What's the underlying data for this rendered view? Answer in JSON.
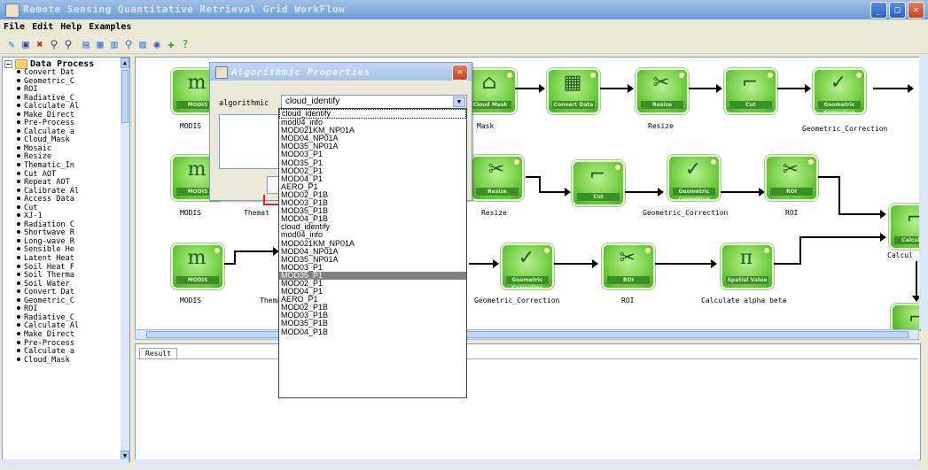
{
  "window": {
    "title": "Remote Sensing Quantitative Retrieval Grid WorkFlow"
  },
  "menu": [
    "File",
    "Edit",
    "Help",
    "Examples"
  ],
  "tree": {
    "root_label": "Data Process",
    "items": [
      "Convert Dat",
      "Geometric_C",
      "ROI",
      "Radiative_C",
      "Calculate Al",
      "Make Direct",
      "Pre-Process",
      "Calculate a",
      "Cloud_Mask",
      "Mosaic",
      "Resize",
      "Thematic_In",
      "Cut AOT",
      "Repeat AOT",
      "Calibrate Al",
      "Access Data",
      "Cut",
      "XJ-1",
      "Radiation C",
      "Shortwave R",
      "Long-wave R",
      "Sensible He",
      "Latent Heat",
      "Soil Heat F",
      "Soil Therma",
      "Soil Water",
      "Convert Dat",
      "Geometric_C",
      "ROI",
      "Radiative_C",
      "Calculate Al",
      "Make Direct",
      "Pre-Process",
      "Calculate a",
      "Cloud_Mask"
    ]
  },
  "canvas": {
    "nodes": [
      {
        "id": "n1",
        "tag": "MODIS",
        "glyph": "m",
        "label": "MODIS"
      },
      {
        "id": "n2",
        "tag": "Cloud Mask",
        "glyph": "⌂",
        "label": "Mask"
      },
      {
        "id": "n3",
        "tag": "Convert Data",
        "glyph": "▦",
        "label": ""
      },
      {
        "id": "n4",
        "tag": "Resize",
        "glyph": "✂",
        "label": "Resize"
      },
      {
        "id": "n5",
        "tag": "Cut",
        "glyph": "⌐",
        "label": ""
      },
      {
        "id": "n6",
        "tag": "Geometric Correction",
        "glyph": "✓",
        "label": "Geometric_Correction"
      },
      {
        "id": "n7",
        "tag": "MODIS",
        "glyph": "m",
        "label": "MODIS"
      },
      {
        "id": "n8",
        "tag": "Resize",
        "glyph": "✂",
        "label": "Resize"
      },
      {
        "id": "n9",
        "tag": "Cut",
        "glyph": "⌐",
        "label": ""
      },
      {
        "id": "n10",
        "tag": "Geometric Correction",
        "glyph": "✓",
        "label": "Geometric_Correction"
      },
      {
        "id": "n11",
        "tag": "ROI",
        "glyph": "✂",
        "label": "ROI"
      },
      {
        "id": "n12",
        "tag": "Calculate",
        "glyph": "⌐",
        "label": "Calcul"
      },
      {
        "id": "n13",
        "tag": "MODIS",
        "glyph": "m",
        "label": "MODIS"
      },
      {
        "id": "n14",
        "tag": "Geometric Correction",
        "glyph": "✓",
        "label": "Geometric_Correction"
      },
      {
        "id": "n15",
        "tag": "ROI",
        "glyph": "✂",
        "label": "ROI"
      },
      {
        "id": "n16",
        "tag": "Spatial Value",
        "glyph": "π",
        "label": "Calculate alpha beta"
      }
    ],
    "partial_labels": {
      "row2_thematic": "Themat",
      "row3_thematic": "Themat"
    }
  },
  "result": {
    "tab_label": "Result"
  },
  "dialog": {
    "title": "Algorithmic Properties",
    "field_label": "algorithmic",
    "selected_value": "cloud_identify",
    "options": [
      "cloud_identify",
      "mod04_info",
      "MOD021KM_NP01A",
      "MOD04_NP01A",
      "MOD35_NP01A",
      "MOD03_P1",
      "MOD35_P1",
      "MOD02_P1",
      "MOD04_P1",
      "AERO_P1",
      "MOD02_P1B",
      "MOD03_P1B",
      "MOD35_P1B",
      "MOD04_P1B",
      "cloud_identify",
      "mod04_info",
      "MOD021KM_NP01A",
      "MOD04_NP01A",
      "MOD35_NP01A",
      "MOD03_P1",
      "MOD35_P1",
      "MOD02_P1",
      "MOD04_P1",
      "AERO_P1",
      "MOD02_P1B",
      "MOD03_P1B",
      "MOD35_P1B",
      "MOD04_P1B"
    ],
    "highlighted_index": 20
  }
}
